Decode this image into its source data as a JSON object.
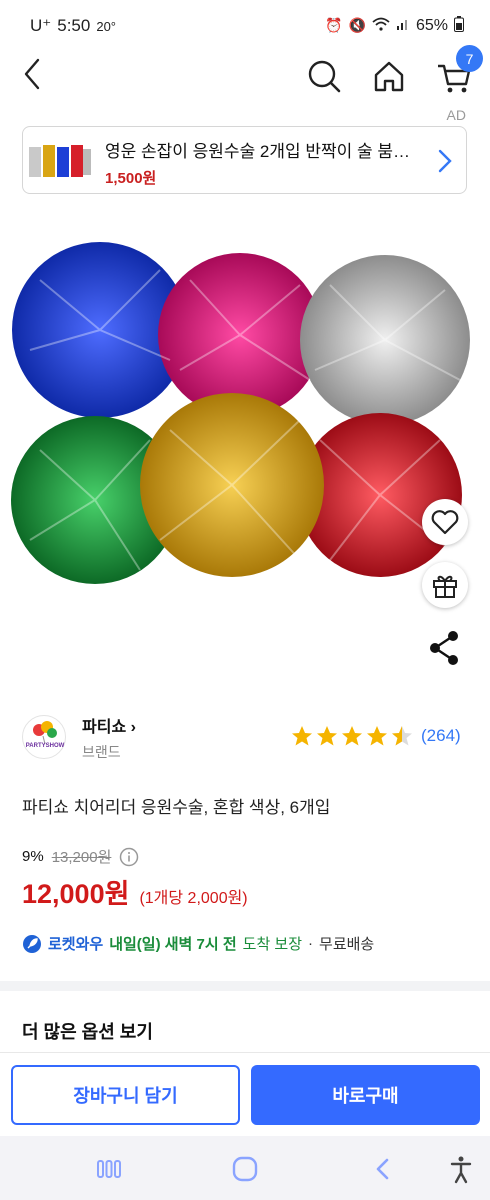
{
  "status_bar": {
    "carrier": "U⁺",
    "time": "5:50",
    "temperature": "20°",
    "battery": "65%"
  },
  "header": {
    "cart_count": "7",
    "icons": [
      "back-icon",
      "search-icon",
      "home-icon",
      "cart-icon"
    ]
  },
  "ad": {
    "label": "AD",
    "title": "영운 손잡이 응원수술 2개입 반짝이 술 붐…",
    "price": "1,500원"
  },
  "product": {
    "brand_name": "파티쇼",
    "brand_sub": "브랜드",
    "logo_text": "PARTYSHOW",
    "rating_count": "(264)",
    "rating_value": 4.5,
    "title": "파티쇼 치어리더 응원수술, 혼합 색상, 6개입",
    "discount_rate": "9%",
    "original_price": "13,200원",
    "sale_price": "12,000원",
    "unit_price": "(1개당 2,000원)",
    "pompom_colors": [
      "#1d3fd6",
      "#e0147a",
      "#c8c8c8",
      "#1f9a3a",
      "#d9a514",
      "#d61f2a"
    ]
  },
  "delivery": {
    "badge": "로켓와우",
    "main": "내일(일) 새벽 7시 전",
    "tail": "도착 보장",
    "separator": "·",
    "free_shipping": "무료배송"
  },
  "more_options": "더 많은 옵션 보기",
  "actions": {
    "add_to_cart": "장바구니 담기",
    "buy_now": "바로구매"
  },
  "colors": {
    "accent": "#346aff",
    "price_red": "#d11a1a",
    "delivery_green": "#1a8c3a",
    "star": "#f5b400"
  }
}
